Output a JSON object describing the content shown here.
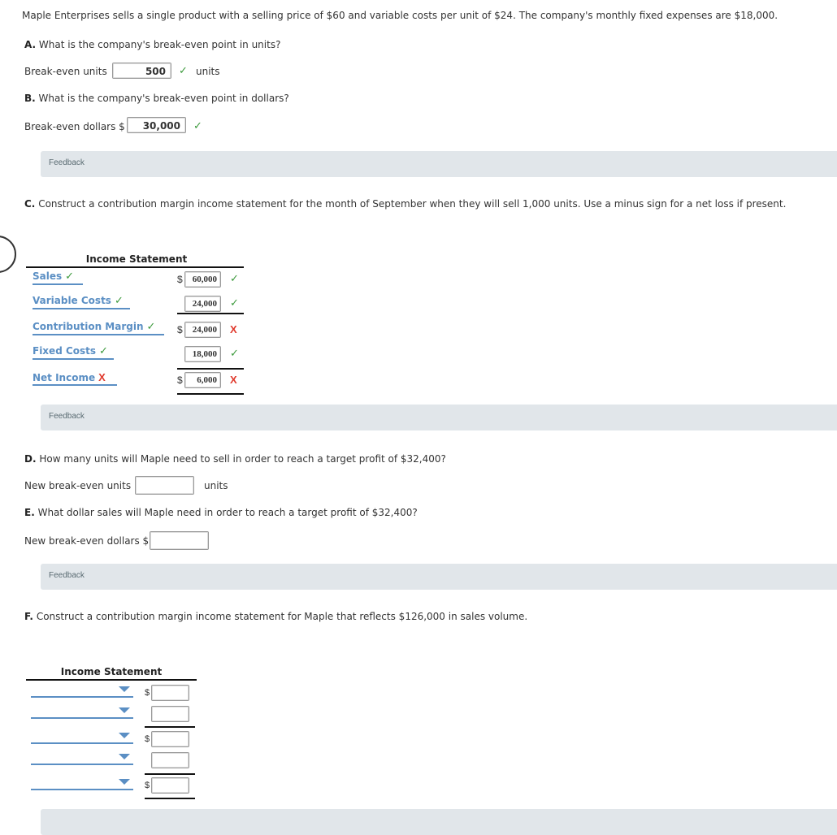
{
  "intro": "Maple Enterprises sells a single product with a selling price of $60 and variable costs per unit of $24. The company's monthly fixed expenses are $18,000.",
  "partA": {
    "letter": "A.",
    "question": " What is the company's break-even point in units?",
    "label": "Break-even units",
    "value": "500",
    "status": "correct",
    "status_glyph": "✓",
    "suffix": "units"
  },
  "partB": {
    "letter": "B.",
    "question": " What is the company's break-even point in dollars?",
    "label": "Break-even dollars $",
    "value": "30,000",
    "status": "correct",
    "status_glyph": "✓"
  },
  "feedback_label": "Feedback",
  "partC": {
    "letter": "C.",
    "question": " Construct a contribution margin income statement for the month of September when they will sell 1,000 units. Use a minus sign for a net loss if present.",
    "statement_title": "Income Statement",
    "rows": [
      {
        "label": "Sales",
        "label_status": "✓",
        "label_correct": true,
        "currency": "$",
        "value": "60,000",
        "value_status": "✓",
        "value_correct": true
      },
      {
        "label": "Variable Costs",
        "label_status": "✓",
        "label_correct": true,
        "currency": "",
        "value": "24,000",
        "value_status": "✓",
        "value_correct": true
      },
      {
        "label": "Contribution Margin",
        "label_status": "✓",
        "label_correct": true,
        "currency": "$",
        "value": "24,000",
        "value_status": "X",
        "value_correct": false
      },
      {
        "label": "Fixed Costs",
        "label_status": "✓",
        "label_correct": true,
        "currency": "",
        "value": "18,000",
        "value_status": "✓",
        "value_correct": true
      },
      {
        "label": "Net Income",
        "label_status": "X",
        "label_correct": false,
        "currency": "$",
        "value": "6,000",
        "value_status": "X",
        "value_correct": false
      }
    ]
  },
  "partD": {
    "letter": "D.",
    "question": " How many units will Maple need to sell in order to reach a target profit of $32,400?",
    "label": "New break-even units",
    "value": "",
    "suffix": "units"
  },
  "partE": {
    "letter": "E.",
    "question": " What dollar sales will Maple need in order to reach a target profit of $32,400?",
    "label": "New break-even dollars $",
    "value": ""
  },
  "partF": {
    "letter": "F.",
    "question": " Construct a contribution margin income statement for Maple that reflects $126,000 in sales volume.",
    "statement_title": "Income Statement",
    "rows": [
      {
        "selected": "",
        "currency": "$",
        "value": ""
      },
      {
        "selected": "",
        "currency": "",
        "value": ""
      },
      {
        "selected": "",
        "currency": "$",
        "value": ""
      },
      {
        "selected": "",
        "currency": "",
        "value": ""
      },
      {
        "selected": "",
        "currency": "$",
        "value": ""
      }
    ]
  },
  "colors": {
    "correct": "#3c9a3c",
    "incorrect": "#e03a2d",
    "link_blue": "#5b8fc4",
    "feedback_bg": "#e1e6ea"
  }
}
